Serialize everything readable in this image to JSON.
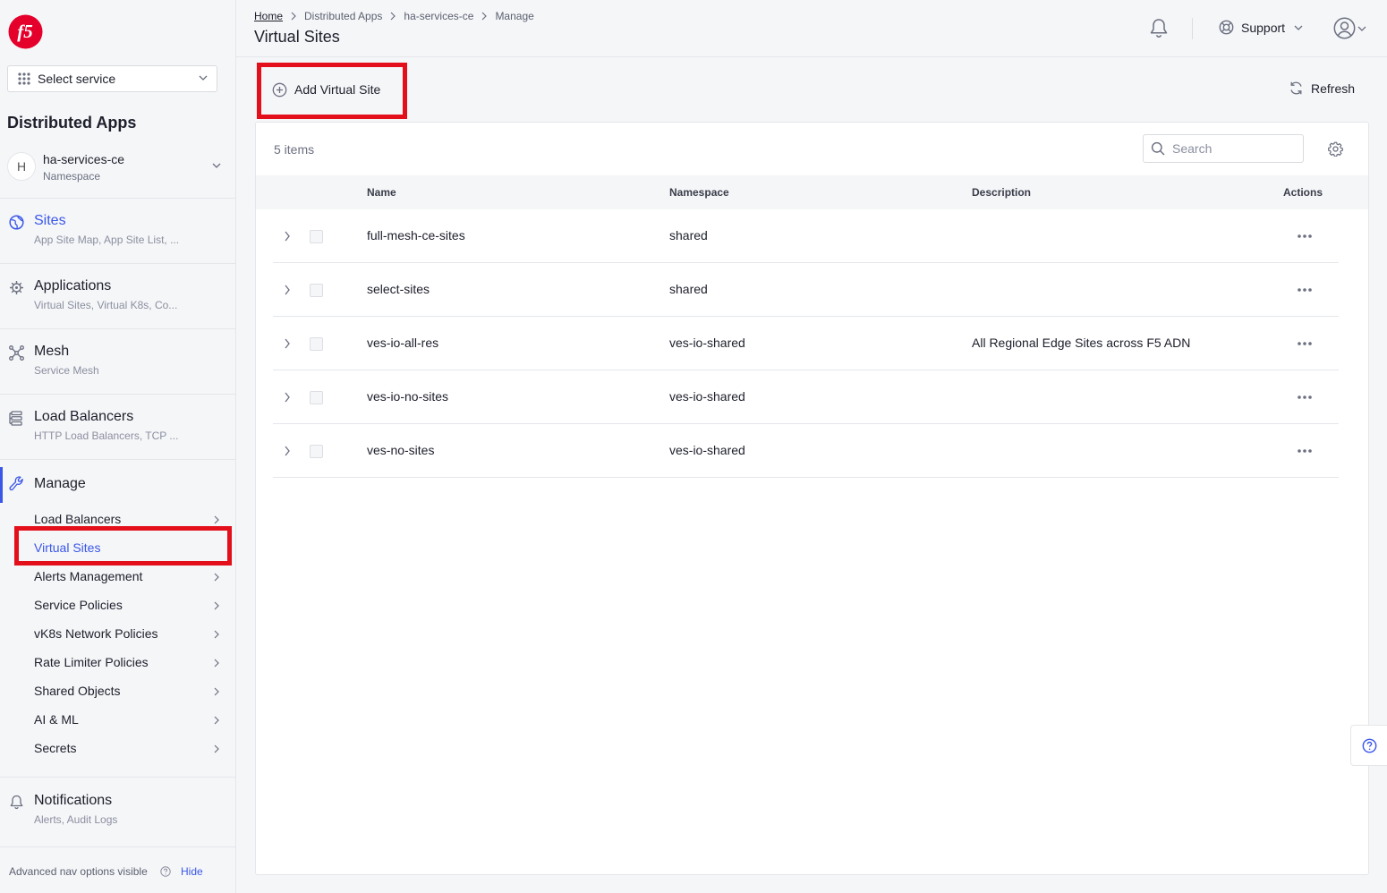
{
  "sidebar": {
    "logo_text": "f5",
    "select_service": "Select service",
    "app_title": "Distributed Apps",
    "namespace": {
      "avatar": "H",
      "name": "ha-services-ce",
      "label": "Namespace"
    },
    "sections": [
      {
        "label": "Sites",
        "sub": "App Site Map, App Site List, ...",
        "icon": "globe-icon"
      },
      {
        "label": "Applications",
        "sub": "Virtual Sites, Virtual K8s, Co...",
        "icon": "helm-icon"
      },
      {
        "label": "Mesh",
        "sub": "Service Mesh",
        "icon": "mesh-icon"
      },
      {
        "label": "Load Balancers",
        "sub": "HTTP Load Balancers, TCP ...",
        "icon": "load-balancer-icon"
      }
    ],
    "manage": {
      "label": "Manage",
      "icon": "wrench-icon",
      "items": [
        {
          "label": "Load Balancers"
        },
        {
          "label": "Virtual Sites"
        },
        {
          "label": "Alerts Management"
        },
        {
          "label": "Service Policies"
        },
        {
          "label": "vK8s Network Policies"
        },
        {
          "label": "Rate Limiter Policies"
        },
        {
          "label": "Shared Objects"
        },
        {
          "label": "AI & ML"
        },
        {
          "label": "Secrets"
        }
      ]
    },
    "notifications": {
      "label": "Notifications",
      "sub": "Alerts, Audit Logs"
    },
    "advanced": {
      "text": "Advanced nav options visible",
      "hide": "Hide"
    }
  },
  "header": {
    "breadcrumbs": [
      "Home",
      "Distributed Apps",
      "ha-services-ce",
      "Manage"
    ],
    "title": "Virtual Sites",
    "support": "Support"
  },
  "toolbar": {
    "add_label": "Add Virtual Site",
    "refresh_label": "Refresh"
  },
  "table": {
    "count": "5 items",
    "search_placeholder": "Search",
    "columns": [
      "Name",
      "Namespace",
      "Description",
      "Actions"
    ],
    "rows": [
      {
        "name": "full-mesh-ce-sites",
        "namespace": "shared",
        "description": ""
      },
      {
        "name": "select-sites",
        "namespace": "shared",
        "description": ""
      },
      {
        "name": "ves-io-all-res",
        "namespace": "ves-io-shared",
        "description": "All Regional Edge Sites across F5 ADN"
      },
      {
        "name": "ves-io-no-sites",
        "namespace": "ves-io-shared",
        "description": ""
      },
      {
        "name": "ves-no-sites",
        "namespace": "ves-io-shared",
        "description": ""
      }
    ]
  },
  "colors": {
    "accent": "#3a57e8",
    "highlight": "#e3101b",
    "logo": "#e4002b"
  }
}
